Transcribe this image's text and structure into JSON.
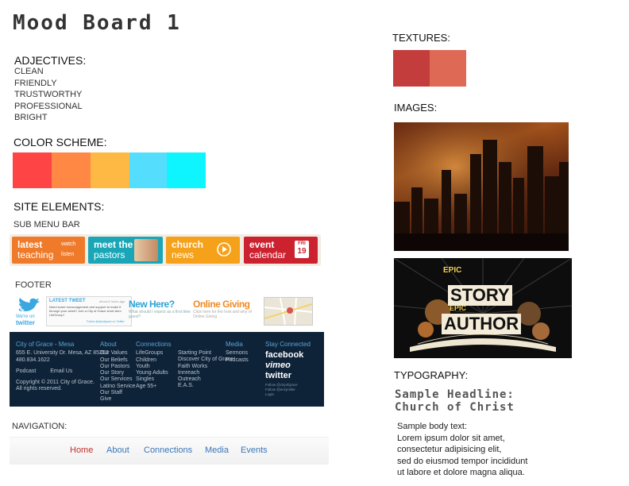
{
  "title": "Mood Board 1",
  "adjectives": {
    "heading": "ADJECTIVES:",
    "items": [
      "CLEAN",
      "FRIENDLY",
      "TRUSTWORTHY",
      "PROFESSIONAL",
      "BRIGHT"
    ]
  },
  "color_scheme": {
    "heading": "COLOR SCHEME:",
    "colors": [
      "#fe4444",
      "#fe8844",
      "#feb844",
      "#55ddfe",
      "#0ff5ff"
    ]
  },
  "site_elements": {
    "heading": "SITE ELEMENTS:",
    "sub_menu_label": "SUB MENU BAR",
    "tiles": [
      {
        "line1": "latest",
        "line2": "teaching",
        "color": "#ef7a2a",
        "extra1": "watch",
        "extra2": "listen"
      },
      {
        "line1": "meet the",
        "line2": "pastors",
        "color": "#1aa6b7"
      },
      {
        "line1": "church",
        "line2": "news",
        "color": "#f6a11a"
      },
      {
        "line1": "event",
        "line2": "calendar",
        "color": "#cc2230",
        "day": "FRI",
        "date": "19"
      }
    ],
    "footer_label": "FOOTER",
    "footer_strip": {
      "twitter_we_on": "We're on",
      "twitter_word": "twitter",
      "latest_tweet": "LATEST TWEET",
      "tweet_time": "about 6 hours ago",
      "tweet_text": "Need some encouragement and support to make it through your week? Join a City of Grace short-term LifeGroup!",
      "follow": "Follow @cityofgrace on Twitter",
      "new_here": "New Here?",
      "new_here_sub": "What should I expect as a first time guest?",
      "giving": "Online Giving",
      "giving_sub": "Click here for the how and why of Online Giving"
    },
    "footer": {
      "church": "City of Grace - Mesa",
      "address": "655 E. University Dr. Mesa, AZ 85203",
      "phone": "480.834.1622",
      "podcast": "Podcast",
      "email": "Email Us",
      "copyright": "Copyright © 2011 City of Grace.",
      "rights": "All rights reserved.",
      "about_head": "About",
      "about": [
        "Our Values",
        "Our Beliefs",
        "Our Pastors",
        "Our Story",
        "Our Services",
        "Latino Service",
        "Our Staff",
        "Give"
      ],
      "conn_head": "Connections",
      "conn1": [
        "LifeGroups",
        "Children",
        "Youth",
        "Young Adults",
        "Singles",
        "Age 55+"
      ],
      "conn2": [
        "Starting Point",
        "Discover City of Grace",
        "Faith Works",
        "Innreach",
        "Outreach",
        "E.A.S."
      ],
      "media_head": "Media",
      "media": [
        "Sermons",
        "Podcasts"
      ],
      "stay_head": "Stay Connected",
      "facebook": "facebook",
      "vimeo": "vimeo",
      "twitter": "twitter",
      "stay_links": [
        "Follow @cityofgrace",
        "Follow @ericjmiller",
        "Login"
      ]
    },
    "navigation_label": "NAVIGATION:",
    "nav": [
      "Home",
      "About",
      "Connections",
      "Media",
      "Events"
    ]
  },
  "textures": {
    "heading": "TEXTURES:",
    "colors": [
      "#c33d3d",
      "#de6a56"
    ]
  },
  "images": {
    "heading": "IMAGES:",
    "poster_lines": [
      "EPIC",
      "STORY",
      "EPIC",
      "AUTHOR"
    ]
  },
  "typography": {
    "heading": "TYPOGRAPHY:",
    "headline1": "Sample Headline:",
    "headline2": "Church of Christ",
    "body": [
      "Sample body text:",
      "Lorem ipsum dolor sit amet,",
      "consectetur adipisicing elit,",
      "sed do eiusmod tempor incididunt",
      "ut labore et dolore magna aliqua."
    ]
  }
}
